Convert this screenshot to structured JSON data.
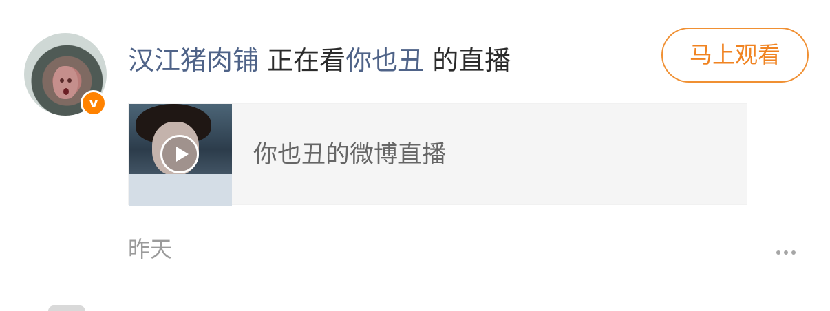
{
  "activity": {
    "user_name": "汉江猪肉铺",
    "action": "正在看",
    "target_name": "你也丑",
    "suffix": "的直播",
    "badge_label": "v"
  },
  "watch_button": {
    "label": "马上观看"
  },
  "live_card": {
    "title": "你也丑的微博直播"
  },
  "post_meta": {
    "time": "昨天"
  },
  "icons": {
    "verified": "verified-v-icon",
    "play": "play-icon",
    "more": "more-dots-icon"
  },
  "colors": {
    "link": "#4f6388",
    "accent": "#f08321",
    "badge": "#ff8200",
    "muted": "#9b9b9b"
  }
}
